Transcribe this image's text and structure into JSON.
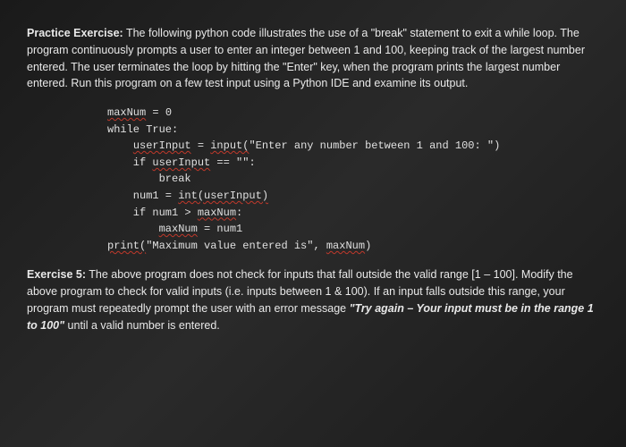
{
  "intro": {
    "label": "Practice Exercise:",
    "text": " The following python code illustrates the use of a \"break\" statement to exit a while loop. The program continuously prompts a user to enter an integer between 1 and 100, keeping track of the largest number entered. The user terminates the loop by hitting the \"Enter\" key, when the program prints the largest number entered.  Run this program on a few test input using a Python IDE and examine its output."
  },
  "code": {
    "l1a": "maxNum",
    "l1b": " = 0",
    "l2": "while True:",
    "l3a": "    ",
    "l3b": "userInput",
    "l3c": " = ",
    "l3d": "input(",
    "l3e": "\"Enter any number between 1 and 100: \")",
    "l4a": "    if ",
    "l4b": "userInput",
    "l4c": " == \"\":",
    "l5": "        break",
    "l6a": "    num1 = ",
    "l6b": "int(userInput)",
    "l7a": "    if num1 > ",
    "l7b": "maxNum",
    "l7c": ":",
    "l8a": "        ",
    "l8b": "maxNum",
    "l8c": " = num1",
    "l9a": "print(",
    "l9b": "\"Maximum value entered is\", ",
    "l9c": "maxNum",
    "l9d": ")"
  },
  "ex5": {
    "label": "Exercise 5:",
    "text1": "  The above program does not check for inputs that fall outside the valid range [1 – 100]. Modify the above program to check for valid inputs (i.e. inputs between 1 & 100). If an input falls outside this range, your program must repeatedly prompt the user with an error message ",
    "emph": "\"Try again – Your input must be in the range 1 to 100\"",
    "text2": " until a valid number is entered."
  }
}
